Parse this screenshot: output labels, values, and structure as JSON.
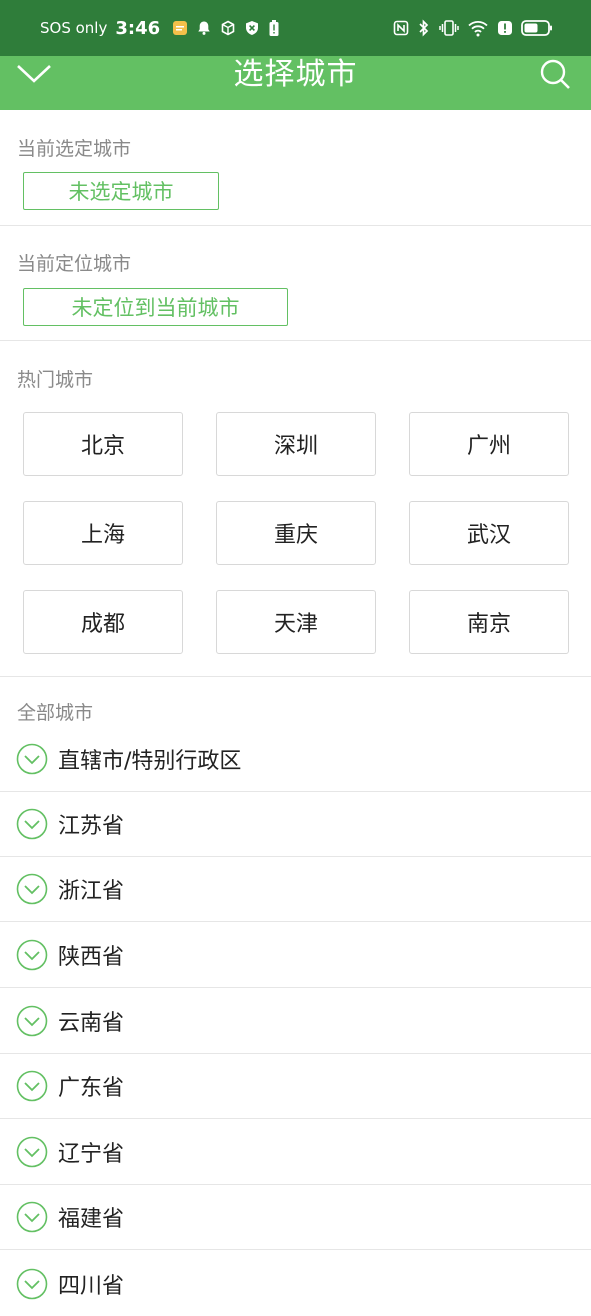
{
  "status_bar": {
    "carrier": "SOS only",
    "time": "3:46"
  },
  "nav": {
    "title": "选择城市",
    "back_icon": "chevron-down-icon",
    "search_icon": "search-icon"
  },
  "selected_city": {
    "label": "当前选定城市",
    "value": "未选定城市"
  },
  "located_city": {
    "label": "当前定位城市",
    "value": "未定位到当前城市"
  },
  "hot_cities": {
    "label": "热门城市",
    "items": [
      "北京",
      "深圳",
      "广州",
      "上海",
      "重庆",
      "武汉",
      "成都",
      "天津",
      "南京"
    ]
  },
  "all_cities": {
    "label": "全部城市",
    "provinces": [
      "直辖市/特别行政区",
      "江苏省",
      "浙江省",
      "陕西省",
      "云南省",
      "广东省",
      "辽宁省",
      "福建省",
      "四川省"
    ]
  },
  "colors": {
    "status_bar": "#2f7d3a",
    "nav_bar": "#63c063",
    "accent": "#63c063"
  }
}
